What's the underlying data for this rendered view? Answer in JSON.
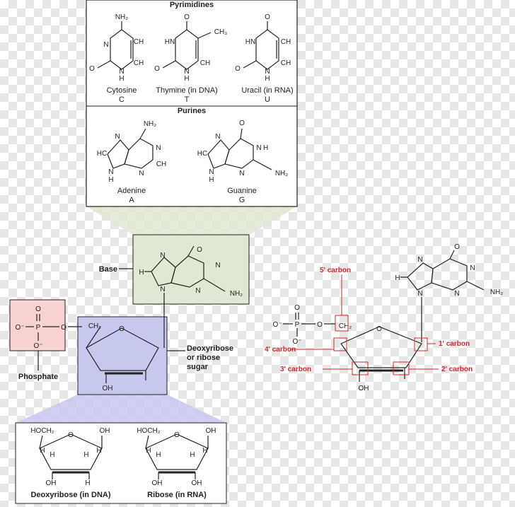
{
  "pyrimidines": {
    "heading": "Pyrimidines",
    "cytosine": {
      "name": "Cytosine",
      "letter": "C"
    },
    "thymine": {
      "name": "Thymine (in DNA)",
      "letter": "T"
    },
    "uracil": {
      "name": "Uracil (in RNA)",
      "letter": "U"
    }
  },
  "purines": {
    "heading": "Purines",
    "adenine": {
      "name": "Adenine",
      "letter": "A"
    },
    "guanine": {
      "name": "Guanine",
      "letter": "G"
    }
  },
  "atoms": {
    "NH2": "NH₂",
    "N": "N",
    "H": "H",
    "O": "O",
    "CH": "CH",
    "HC": "HC",
    "CH3": "CH₃",
    "OH": "OH",
    "H_C": "H",
    "CH2": "CH₂",
    "HOCH2": "HOCH₂",
    "P": "P",
    "Ominus": "O⁻"
  },
  "nucleotide": {
    "base_label": "Base",
    "sugar_label_line1": "Deoxyribose",
    "sugar_label_line2": "or ribose",
    "sugar_label_line3": "sugar",
    "phosphate_label": "Phosphate"
  },
  "carbons": {
    "c5": "5' carbon",
    "c4": "4' carbon",
    "c3": "3' carbon",
    "c2": "2' carbon",
    "c1": "1' carbon"
  },
  "sugars": {
    "deoxyribose": "Deoxyribose (in DNA)",
    "ribose": "Ribose (in RNA)"
  },
  "colors": {
    "cytosine": "#cfe3c8",
    "thymine": "#fbe0a4",
    "uracil": "#c9c9c0",
    "adenine_ring": "#f3b9a4",
    "adenine_ring2": "#f3b9a4",
    "guanine_ring": "#a8d8ee",
    "guanine_ring2": "#b9dcf2",
    "base_box": "#dfe8d2",
    "sugar_box": "#c7c8ee",
    "phosphate_box": "#f7d2d0",
    "ribose_fill": "#fbd9a2",
    "red": "#d8262b"
  }
}
